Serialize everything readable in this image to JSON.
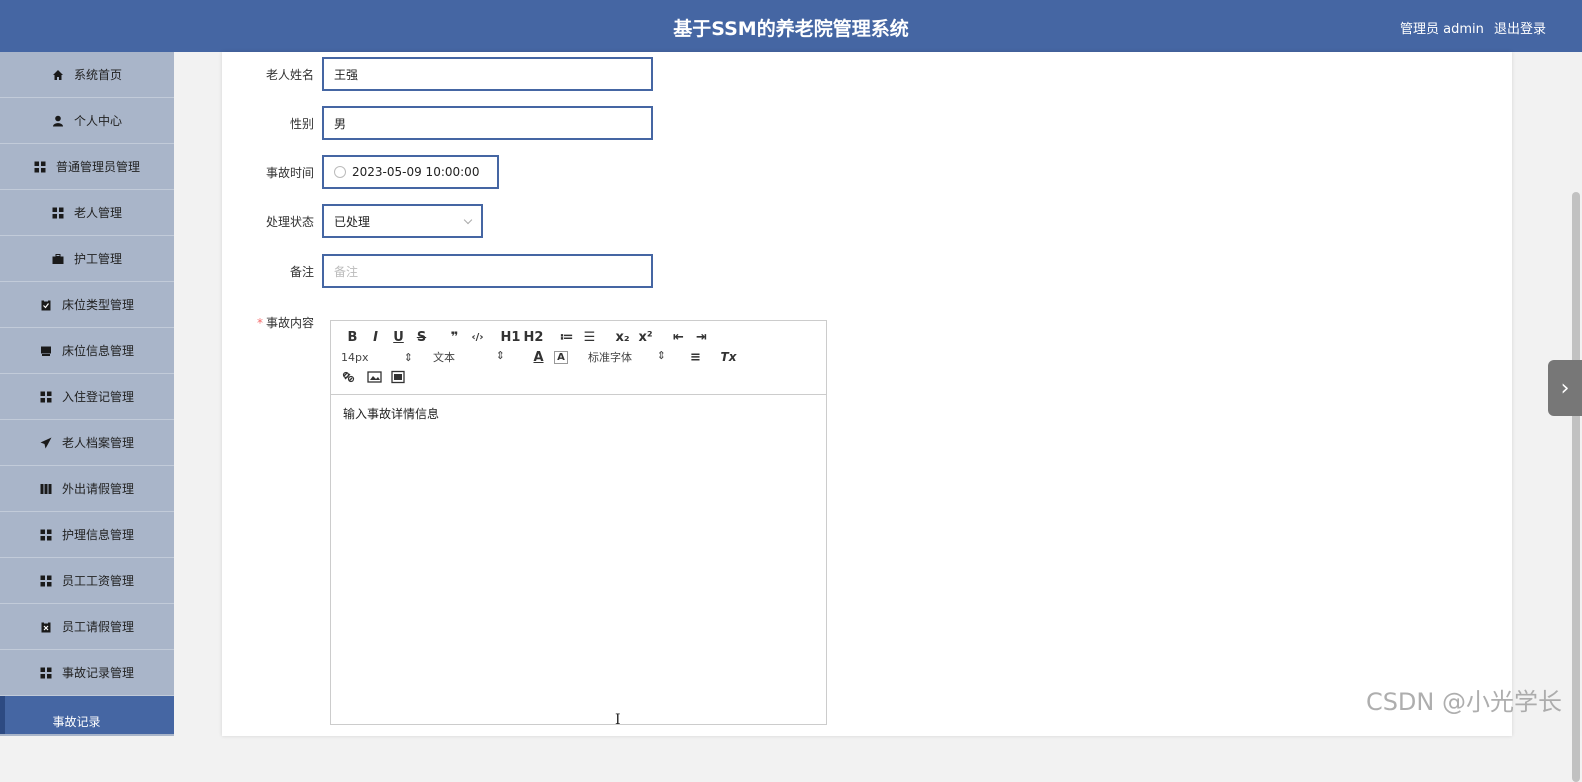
{
  "header": {
    "title": "基于SSM的养老院管理系统",
    "user_label": "管理员 admin",
    "logout_label": "退出登录"
  },
  "sidebar": {
    "items": [
      {
        "label": "系统首页",
        "icon": "home-icon"
      },
      {
        "label": "个人中心",
        "icon": "user-icon"
      },
      {
        "label": "普通管理员管理",
        "icon": "grid-icon"
      },
      {
        "label": "老人管理",
        "icon": "grid-icon"
      },
      {
        "label": "护工管理",
        "icon": "briefcase-icon"
      },
      {
        "label": "床位类型管理",
        "icon": "clipboard-icon"
      },
      {
        "label": "床位信息管理",
        "icon": "bed-icon"
      },
      {
        "label": "入住登记管理",
        "icon": "grid-icon"
      },
      {
        "label": "老人档案管理",
        "icon": "send-icon"
      },
      {
        "label": "外出请假管理",
        "icon": "book-icon"
      },
      {
        "label": "护理信息管理",
        "icon": "grid-icon"
      },
      {
        "label": "员工工资管理",
        "icon": "grid-icon"
      },
      {
        "label": "员工请假管理",
        "icon": "clipboard-x-icon"
      },
      {
        "label": "事故记录管理",
        "icon": "grid-icon"
      }
    ],
    "active_submenu": "事故记录"
  },
  "form": {
    "elder_name": {
      "label": "老人姓名",
      "value": "王强"
    },
    "gender": {
      "label": "性别",
      "value": "男"
    },
    "accident_time": {
      "label": "事故时间",
      "value": "2023-05-09 10:00:00"
    },
    "status": {
      "label": "处理状态",
      "value": "已处理"
    },
    "remark": {
      "label": "备注",
      "placeholder": "备注"
    },
    "content": {
      "label": "事故内容",
      "required_mark": "*",
      "text": "输入事故详情信息"
    }
  },
  "editor": {
    "toolbar_row1": [
      "B",
      "I",
      "U",
      "S",
      "❞",
      "‹/›",
      "H1",
      "H2",
      "≔",
      "☰",
      "x₂",
      "x²",
      "⇤",
      "⇥"
    ],
    "font_size": "14px",
    "block_type": "文本",
    "font_family": "标准字体",
    "clear_format": "Tx"
  },
  "watermark": "CSDN @小光学长"
}
